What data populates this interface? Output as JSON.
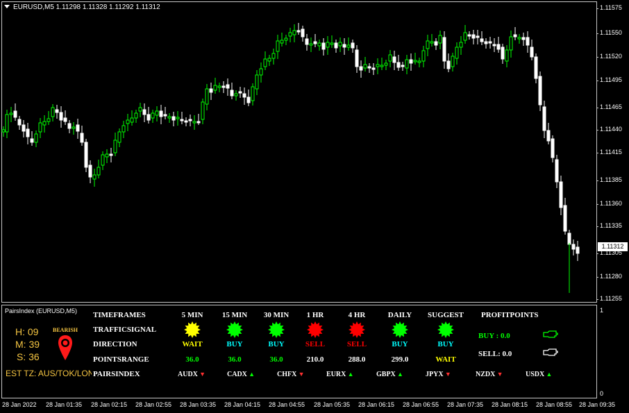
{
  "chart": {
    "title": "EURUSD,M5  1.11298 1.11328 1.11292 1.11312",
    "current_price": "1.11312",
    "price_labels": [
      "1.11575",
      "1.11550",
      "1.11520",
      "1.11495",
      "1.11465",
      "1.11440",
      "1.11415",
      "1.11385",
      "1.11360",
      "1.11335",
      "1.11305",
      "1.11280",
      "1.11255"
    ],
    "time_labels": [
      "28 Jan 2022",
      "28 Jan 01:35",
      "28 Jan 02:15",
      "28 Jan 02:55",
      "28 Jan 03:35",
      "28 Jan 04:15",
      "28 Jan 04:55",
      "28 Jan 05:35",
      "28 Jan 06:15",
      "28 Jan 06:55",
      "28 Jan 07:35",
      "28 Jan 08:15",
      "28 Jan 08:55",
      "28 Jan 09:35"
    ],
    "bull_color": "#00ff00",
    "bear_color": "#ffffff"
  },
  "indicator": {
    "title": "PairsIndex (EURUSD,M5)",
    "scale_top": "1",
    "scale_bottom": "0",
    "clock": {
      "h": "H: 09",
      "m": "M: 39",
      "s": "S: 36"
    },
    "bias_label": "BEARISH",
    "est_tz": "EST TZ:  AUS/TOK/LON",
    "row_labels": {
      "timeframes": "TIMEFRAMES",
      "traffic": "TRAFFICSIGNAL",
      "direction": "DIRECTION",
      "range": "POINTSRANGE",
      "pairs": "PAIRSINDEX"
    },
    "columns": [
      {
        "header": "5 MIN",
        "signal_color": "#ffff00",
        "direction": "WAIT",
        "dir_color": "#ffff00",
        "points": "36.0",
        "pts_color": "#00ff00"
      },
      {
        "header": "15 MIN",
        "signal_color": "#00ff00",
        "direction": "BUY",
        "dir_color": "#00ffff",
        "points": "36.0",
        "pts_color": "#00ff00"
      },
      {
        "header": "30 MIN",
        "signal_color": "#00ff00",
        "direction": "BUY",
        "dir_color": "#00ffff",
        "points": "36.0",
        "pts_color": "#00ff00"
      },
      {
        "header": "1 HR",
        "signal_color": "#ff0000",
        "direction": "SELL",
        "dir_color": "#ff0000",
        "points": "210.0",
        "pts_color": "#ffffff"
      },
      {
        "header": "4 HR",
        "signal_color": "#ff0000",
        "direction": "SELL",
        "dir_color": "#ff0000",
        "points": "288.0",
        "pts_color": "#ffffff"
      },
      {
        "header": "DAILY",
        "signal_color": "#00ff00",
        "direction": "BUY",
        "dir_color": "#00ffff",
        "points": "299.0",
        "pts_color": "#ffffff"
      },
      {
        "header": "SUGGEST",
        "signal_color": "#00ff00",
        "direction": "BUY",
        "dir_color": "#00ffff",
        "points": "WAIT",
        "pts_color": "#ffff00"
      }
    ],
    "profit": {
      "header": "PROFITPOINTS",
      "buy": "BUY :  0.0",
      "buy_color": "#00ff00",
      "sell": "SELL:  0.0",
      "sell_color": "#ffffff"
    },
    "pairs": [
      {
        "name": "AUDX",
        "dir": "down",
        "color": "#ff3030"
      },
      {
        "name": "CADX",
        "dir": "up",
        "color": "#00ff00"
      },
      {
        "name": "CHFX",
        "dir": "down",
        "color": "#ff3030"
      },
      {
        "name": "EURX",
        "dir": "up",
        "color": "#00ff00"
      },
      {
        "name": "GBPX",
        "dir": "up",
        "color": "#00ff00"
      },
      {
        "name": "JPYX",
        "dir": "down",
        "color": "#ff3030"
      },
      {
        "name": "NZDX",
        "dir": "down",
        "color": "#ff3030"
      },
      {
        "name": "USDX",
        "dir": "up",
        "color": "#00ff00"
      }
    ]
  }
}
